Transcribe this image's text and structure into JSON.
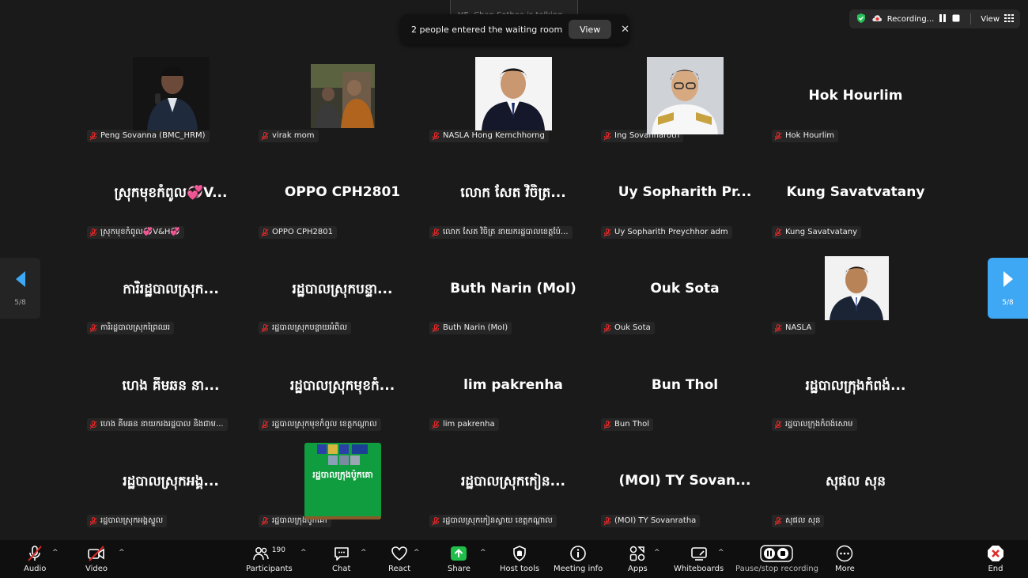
{
  "talking": "HE. Chan Sothea is talking...",
  "toast": {
    "message": "2 people entered the waiting room",
    "view_label": "View"
  },
  "topbar": {
    "recording_label": "Recording...",
    "view_label": "View"
  },
  "pager": {
    "left_page": "5/8",
    "right_page": "5/8"
  },
  "tiles": [
    {
      "name": "",
      "label": "Peng Sovanna (BMC_HRM)"
    },
    {
      "name": "",
      "label": "virak mom"
    },
    {
      "name": "",
      "label": "NASLA Hong Kemchhorng"
    },
    {
      "name": "",
      "label": "Ing Sovannaroth"
    },
    {
      "name": "Hok Hourlim",
      "label": "Hok Hourlim"
    },
    {
      "name": "ស្រុកមុខកំពូល💞V...",
      "label": "ស្រុកមុខកំពូល💞V&H💞"
    },
    {
      "name": "OPPO CPH2801",
      "label": "OPPO CPH2801"
    },
    {
      "name": "លោក សែត វិចិត្រ...",
      "label": "លោក សែត វិចិត្រ នាយករដ្ឋបាលខេត្តប៉ែ..."
    },
    {
      "name": "Uy Sopharith Pr...",
      "label": "Uy Sopharith Preychhor adm"
    },
    {
      "name": "Kung Savatvatany",
      "label": "Kung Savatvatany"
    },
    {
      "name": "ការិរដ្ឋបាលស្រុក...",
      "label": "ការិរដ្ឋបាលស្រុកព្រៃឈរ"
    },
    {
      "name": "រដ្ឋបាលស្រុកបន្ទា...",
      "label": "រដ្ឋបាលស្រុកបន្ទាយអំពិល"
    },
    {
      "name": "Buth Narin (MoI)",
      "label": "Buth Narin (MoI)"
    },
    {
      "name": "Ouk Sota",
      "label": "Ouk Sota"
    },
    {
      "name": "",
      "label": "NASLA"
    },
    {
      "name": "ហេង គីមឆន នា...",
      "label": "ហេង គីមឆន នាយករងរដ្ឋបាល និងជាម..."
    },
    {
      "name": "រដ្ឋបាលស្រុកមុខកំ...",
      "label": "រដ្ឋបាលស្រុកមុខកំពូល ខេត្តកណ្ដាល"
    },
    {
      "name": "lim pakrenha",
      "label": "lim pakrenha"
    },
    {
      "name": "Bun Thol",
      "label": "Bun Thol"
    },
    {
      "name": "រដ្ឋបាលក្រុងកំពង់...",
      "label": "រដ្ឋបាលក្រុងកំពង់សោម"
    },
    {
      "name": "រដ្ឋបាលស្រុកអង្គ...",
      "label": "រដ្ឋបាលស្រុកអង្គស្នួល"
    },
    {
      "name": "",
      "label": "រដ្ឋបាលក្រុងប៉ូកគោ",
      "avatar_text": "រដ្ឋបាលក្រុងប៉ូកគោ"
    },
    {
      "name": "រដ្ឋបាលស្រុកកៀន...",
      "label": "រដ្ឋបាលស្រុកកៀនស្វាយ ខេត្តកណ្ដាល"
    },
    {
      "name": "(MOI) TY Sovan...",
      "label": "(MOI) TY Sovanratha"
    },
    {
      "name": "សុផល សុន",
      "label": "សុផល សុន"
    }
  ],
  "toolbar": {
    "audio": "Audio",
    "video": "Video",
    "participants": "Participants",
    "participants_count": "190",
    "chat": "Chat",
    "react": "React",
    "share": "Share",
    "host_tools": "Host tools",
    "meeting_info": "Meeting info",
    "apps": "Apps",
    "whiteboards": "Whiteboards",
    "pause_stop": "Pause/stop recording",
    "more": "More",
    "end": "End"
  },
  "colors": {
    "share_green": "#1fbf4a",
    "end_red": "#e02828",
    "pager_blue": "#3ea8f5"
  }
}
